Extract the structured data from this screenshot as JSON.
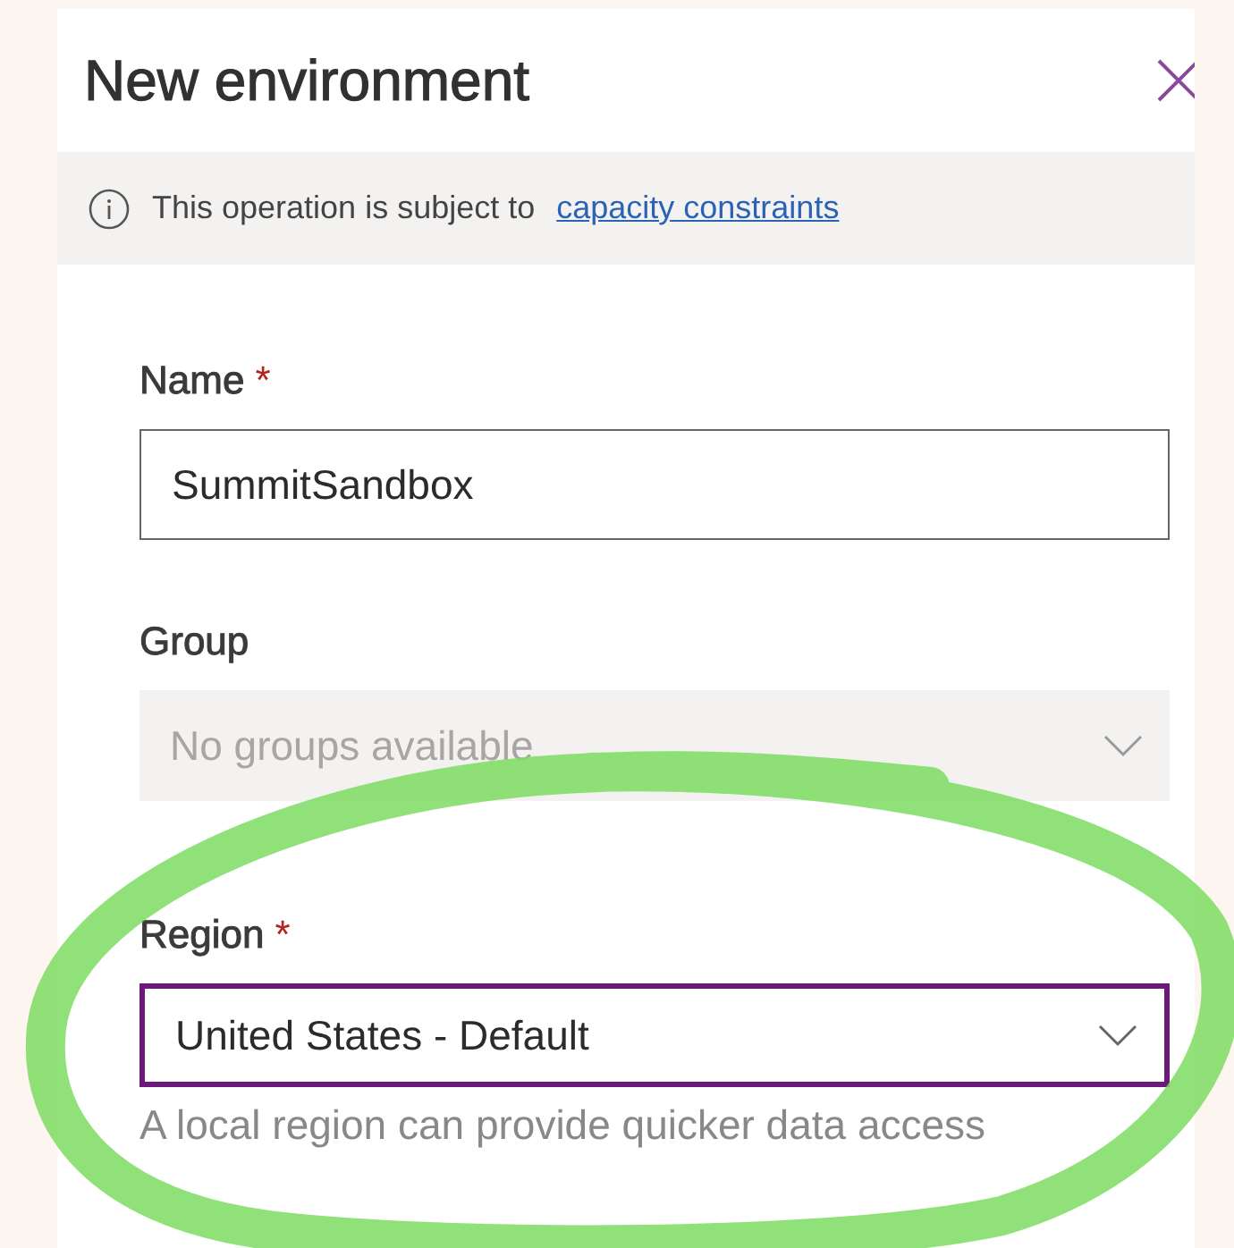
{
  "panel": {
    "title": "New environment"
  },
  "notice": {
    "text": "This operation is subject to",
    "link": "capacity constraints"
  },
  "fields": [
    {
      "kind": "text",
      "label": "Name",
      "required_mark": "*",
      "value": "SummitSandbox",
      "disabled": false,
      "focused": false
    },
    {
      "kind": "dropdown",
      "label": "Group",
      "value": "No groups available",
      "disabled": true,
      "focused": false
    },
    {
      "kind": "dropdown",
      "label": "Region",
      "required_mark": "*",
      "value": "United States - Default",
      "disabled": false,
      "focused": true,
      "help": "A local region can provide quicker data access"
    }
  ]
}
